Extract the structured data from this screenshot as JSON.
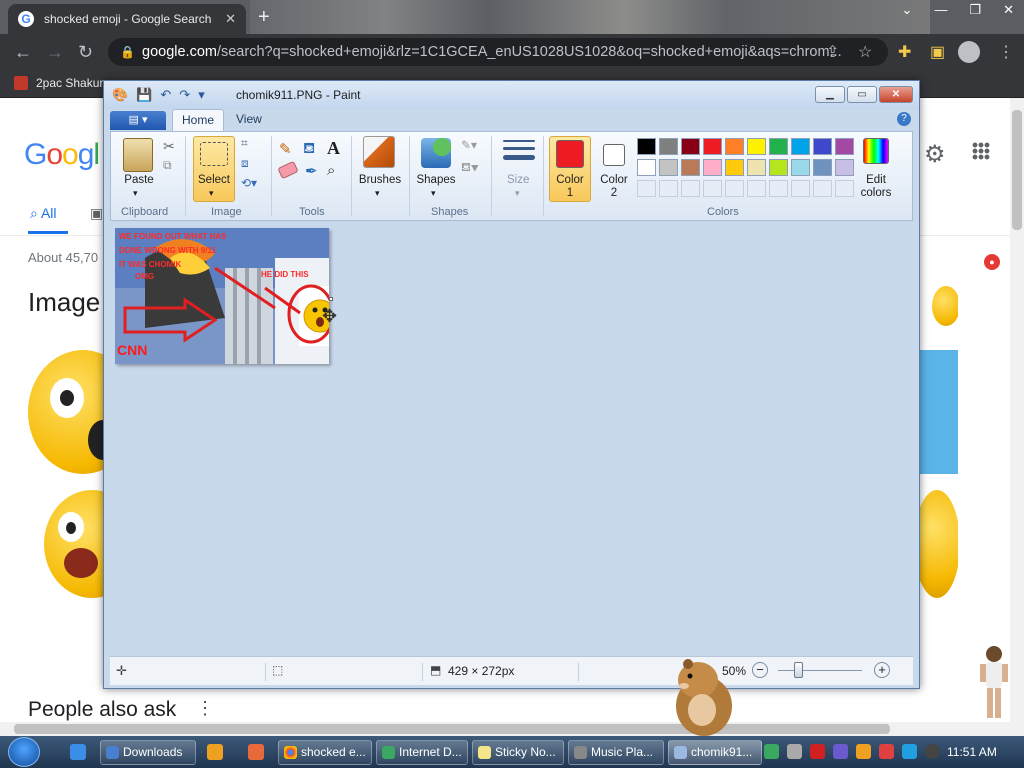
{
  "browser": {
    "tab_title": "shocked emoji - Google Search",
    "tab_close": "✕",
    "new_tab": "+",
    "url_host": "google.com",
    "url_rest": "/search?q=shocked+emoji&rlz=1C1GCEA_enUS1028US1028&oq=shocked+emoji&aqs=chrom...",
    "bookmark_1": "2pac Shakur"
  },
  "google": {
    "logo_letters": [
      "G",
      "o",
      "o",
      "g",
      "l"
    ],
    "tab_all": "All",
    "about": "About 45,70",
    "images_heading": "Image",
    "people_also_ask": "People also ask",
    "more_dots": "⋮"
  },
  "paint": {
    "title": "chomik911.PNG - Paint",
    "tabs": {
      "home": "Home",
      "view": "View"
    },
    "ribbon": {
      "paste": "Paste",
      "select": "Select",
      "brushes": "Brushes",
      "shapes": "Shapes",
      "size": "Size",
      "color1": "Color",
      "color1_num": "1",
      "color2": "Color",
      "color2_num": "2",
      "edit_colors_1": "Edit",
      "edit_colors_2": "colors",
      "groups": {
        "clipboard": "Clipboard",
        "image": "Image",
        "tools": "Tools",
        "shapes": "Shapes",
        "colors": "Colors"
      }
    },
    "palette_row1": [
      "#000000",
      "#7f7f7f",
      "#880015",
      "#ed1c24",
      "#ff7f27",
      "#fff200",
      "#22b14c",
      "#00a2e8",
      "#3f48cc",
      "#a349a4"
    ],
    "palette_row2": [
      "#ffffff",
      "#c3c3c3",
      "#b97a57",
      "#ffaec9",
      "#ffc90e",
      "#efe4b0",
      "#b5e61d",
      "#99d9ea",
      "#7092be",
      "#c8bfe7"
    ],
    "color1_value": "#ed1c24",
    "color2_value": "#ffffff",
    "image_text": {
      "line1": "WE FOUND OUT WHAT HAS",
      "line2": "DONE WRONG WITH 9/11",
      "line3": "IT WAS CHOMIK",
      "line4": "OMG",
      "line5": "HE DID THIS",
      "news": "CNN"
    },
    "status": {
      "dimensions": "429 × 272px",
      "zoom": "50%",
      "zoom_out": "−",
      "zoom_in": "+"
    }
  },
  "taskbar": {
    "items": [
      "Downloads",
      "",
      "shocked e...",
      "Internet D...",
      "Sticky No...",
      "Music Pla...",
      "chomik91..."
    ],
    "clock": "11:51 AM"
  }
}
